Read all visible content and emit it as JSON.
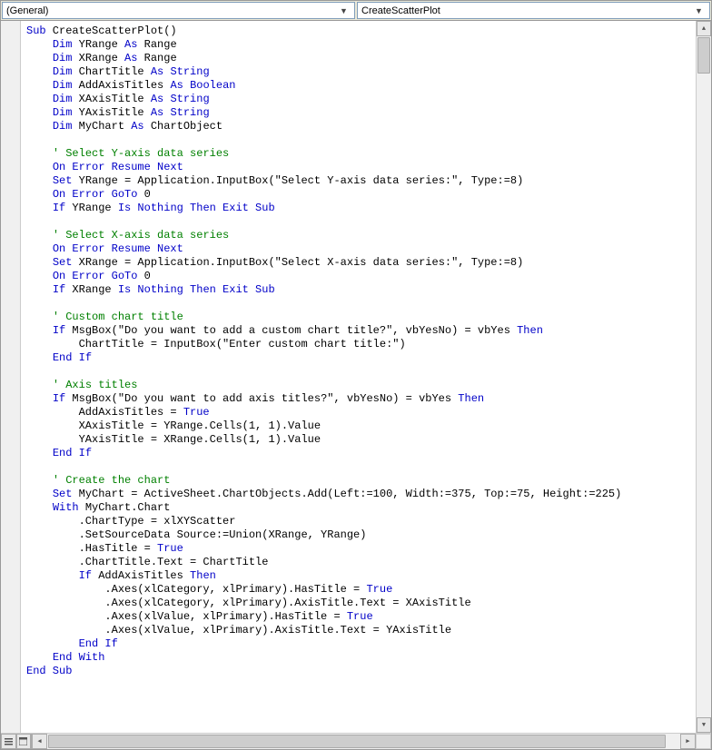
{
  "dropdown_left": "(General)",
  "dropdown_right": "CreateScatterPlot",
  "code_tokens": [
    [
      [
        "kw",
        "Sub"
      ],
      [
        "p",
        " CreateScatterPlot()"
      ]
    ],
    [
      [
        "i1",
        ""
      ],
      [
        "kw",
        "Dim"
      ],
      [
        "p",
        " YRange "
      ],
      [
        "kw",
        "As"
      ],
      [
        "p",
        " Range"
      ]
    ],
    [
      [
        "i1",
        ""
      ],
      [
        "kw",
        "Dim"
      ],
      [
        "p",
        " XRange "
      ],
      [
        "kw",
        "As"
      ],
      [
        "p",
        " Range"
      ]
    ],
    [
      [
        "i1",
        ""
      ],
      [
        "kw",
        "Dim"
      ],
      [
        "p",
        " ChartTitle "
      ],
      [
        "kw",
        "As"
      ],
      [
        "p",
        " "
      ],
      [
        "kw",
        "String"
      ]
    ],
    [
      [
        "i1",
        ""
      ],
      [
        "kw",
        "Dim"
      ],
      [
        "p",
        " AddAxisTitles "
      ],
      [
        "kw",
        "As"
      ],
      [
        "p",
        " "
      ],
      [
        "kw",
        "Boolean"
      ]
    ],
    [
      [
        "i1",
        ""
      ],
      [
        "kw",
        "Dim"
      ],
      [
        "p",
        " XAxisTitle "
      ],
      [
        "kw",
        "As"
      ],
      [
        "p",
        " "
      ],
      [
        "kw",
        "String"
      ]
    ],
    [
      [
        "i1",
        ""
      ],
      [
        "kw",
        "Dim"
      ],
      [
        "p",
        " YAxisTitle "
      ],
      [
        "kw",
        "As"
      ],
      [
        "p",
        " "
      ],
      [
        "kw",
        "String"
      ]
    ],
    [
      [
        "i1",
        ""
      ],
      [
        "kw",
        "Dim"
      ],
      [
        "p",
        " MyChart "
      ],
      [
        "kw",
        "As"
      ],
      [
        "p",
        " ChartObject"
      ]
    ],
    [
      [
        "p",
        ""
      ]
    ],
    [
      [
        "i1",
        ""
      ],
      [
        "cm",
        "' Select Y-axis data series"
      ]
    ],
    [
      [
        "i1",
        ""
      ],
      [
        "kw",
        "On Error Resume Next"
      ]
    ],
    [
      [
        "i1",
        ""
      ],
      [
        "kw",
        "Set"
      ],
      [
        "p",
        " YRange = Application.InputBox(\"Select Y-axis data series:\", Type:=8)"
      ]
    ],
    [
      [
        "i1",
        ""
      ],
      [
        "kw",
        "On Error GoTo"
      ],
      [
        "p",
        " 0"
      ]
    ],
    [
      [
        "i1",
        ""
      ],
      [
        "kw",
        "If"
      ],
      [
        "p",
        " YRange "
      ],
      [
        "kw",
        "Is Nothing Then Exit Sub"
      ]
    ],
    [
      [
        "p",
        ""
      ]
    ],
    [
      [
        "i1",
        ""
      ],
      [
        "cm",
        "' Select X-axis data series"
      ]
    ],
    [
      [
        "i1",
        ""
      ],
      [
        "kw",
        "On Error Resume Next"
      ]
    ],
    [
      [
        "i1",
        ""
      ],
      [
        "kw",
        "Set"
      ],
      [
        "p",
        " XRange = Application.InputBox(\"Select X-axis data series:\", Type:=8)"
      ]
    ],
    [
      [
        "i1",
        ""
      ],
      [
        "kw",
        "On Error GoTo"
      ],
      [
        "p",
        " 0"
      ]
    ],
    [
      [
        "i1",
        ""
      ],
      [
        "kw",
        "If"
      ],
      [
        "p",
        " XRange "
      ],
      [
        "kw",
        "Is Nothing Then Exit Sub"
      ]
    ],
    [
      [
        "p",
        ""
      ]
    ],
    [
      [
        "i1",
        ""
      ],
      [
        "cm",
        "' Custom chart title"
      ]
    ],
    [
      [
        "i1",
        ""
      ],
      [
        "kw",
        "If"
      ],
      [
        "p",
        " MsgBox(\"Do you want to add a custom chart title?\", vbYesNo) = vbYes "
      ],
      [
        "kw",
        "Then"
      ]
    ],
    [
      [
        "i2",
        ""
      ],
      [
        "p",
        "ChartTitle = InputBox(\"Enter custom chart title:\")"
      ]
    ],
    [
      [
        "i1",
        ""
      ],
      [
        "kw",
        "End If"
      ]
    ],
    [
      [
        "p",
        ""
      ]
    ],
    [
      [
        "i1",
        ""
      ],
      [
        "cm",
        "' Axis titles"
      ]
    ],
    [
      [
        "i1",
        ""
      ],
      [
        "kw",
        "If"
      ],
      [
        "p",
        " MsgBox(\"Do you want to add axis titles?\", vbYesNo) = vbYes "
      ],
      [
        "kw",
        "Then"
      ]
    ],
    [
      [
        "i2",
        ""
      ],
      [
        "p",
        "AddAxisTitles = "
      ],
      [
        "kw",
        "True"
      ]
    ],
    [
      [
        "i2",
        ""
      ],
      [
        "p",
        "XAxisTitle = YRange.Cells(1, 1).Value"
      ]
    ],
    [
      [
        "i2",
        ""
      ],
      [
        "p",
        "YAxisTitle = XRange.Cells(1, 1).Value"
      ]
    ],
    [
      [
        "i1",
        ""
      ],
      [
        "kw",
        "End If"
      ]
    ],
    [
      [
        "p",
        ""
      ]
    ],
    [
      [
        "i1",
        ""
      ],
      [
        "cm",
        "' Create the chart"
      ]
    ],
    [
      [
        "i1",
        ""
      ],
      [
        "kw",
        "Set"
      ],
      [
        "p",
        " MyChart = ActiveSheet.ChartObjects.Add(Left:=100, Width:=375, Top:=75, Height:=225)"
      ]
    ],
    [
      [
        "i1",
        ""
      ],
      [
        "kw",
        "With"
      ],
      [
        "p",
        " MyChart.Chart"
      ]
    ],
    [
      [
        "i2",
        ""
      ],
      [
        "p",
        ".ChartType = xlXYScatter"
      ]
    ],
    [
      [
        "i2",
        ""
      ],
      [
        "p",
        ".SetSourceData Source:=Union(XRange, YRange)"
      ]
    ],
    [
      [
        "i2",
        ""
      ],
      [
        "p",
        ".HasTitle = "
      ],
      [
        "kw",
        "True"
      ]
    ],
    [
      [
        "i2",
        ""
      ],
      [
        "p",
        ".ChartTitle.Text = ChartTitle"
      ]
    ],
    [
      [
        "i2",
        ""
      ],
      [
        "kw",
        "If"
      ],
      [
        "p",
        " AddAxisTitles "
      ],
      [
        "kw",
        "Then"
      ]
    ],
    [
      [
        "i3",
        ""
      ],
      [
        "p",
        ".Axes(xlCategory, xlPrimary).HasTitle = "
      ],
      [
        "kw",
        "True"
      ]
    ],
    [
      [
        "i3",
        ""
      ],
      [
        "p",
        ".Axes(xlCategory, xlPrimary).AxisTitle.Text = XAxisTitle"
      ]
    ],
    [
      [
        "i3",
        ""
      ],
      [
        "p",
        ".Axes(xlValue, xlPrimary).HasTitle = "
      ],
      [
        "kw",
        "True"
      ]
    ],
    [
      [
        "i3",
        ""
      ],
      [
        "p",
        ".Axes(xlValue, xlPrimary).AxisTitle.Text = YAxisTitle"
      ]
    ],
    [
      [
        "i2",
        ""
      ],
      [
        "kw",
        "End If"
      ]
    ],
    [
      [
        "i1",
        ""
      ],
      [
        "kw",
        "End With"
      ]
    ],
    [
      [
        "kw",
        "End Sub"
      ]
    ]
  ]
}
